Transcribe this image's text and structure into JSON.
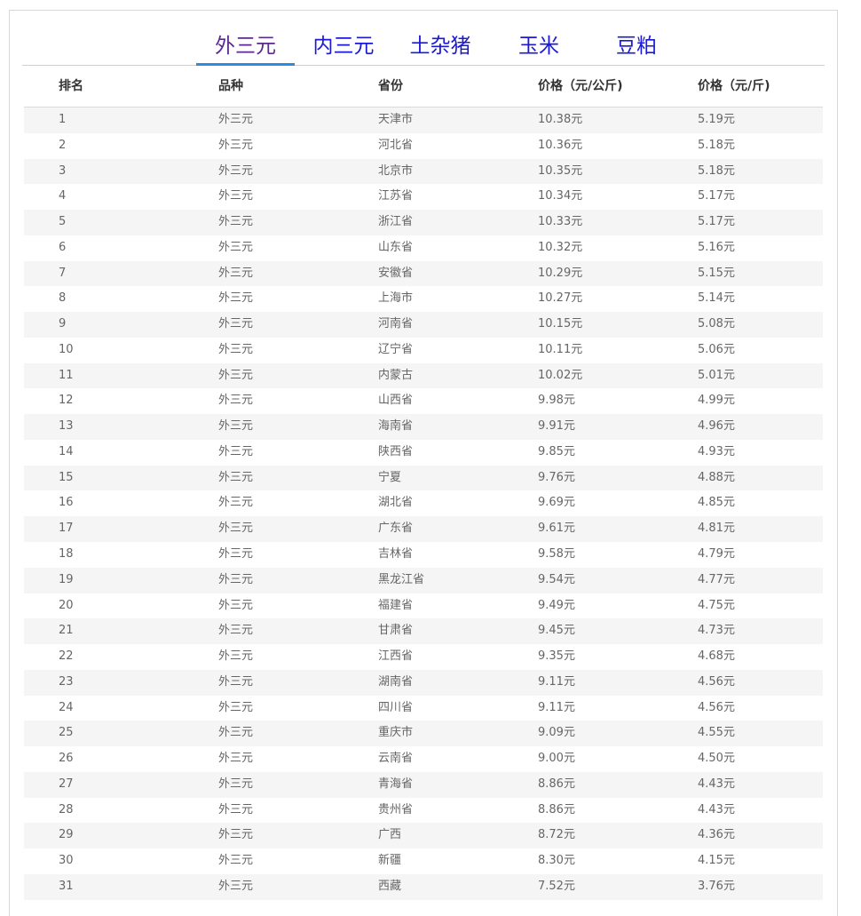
{
  "tabs": [
    {
      "label": "外三元",
      "active": true
    },
    {
      "label": "内三元",
      "active": false
    },
    {
      "label": "土杂猪",
      "active": false
    },
    {
      "label": "玉米",
      "active": false
    },
    {
      "label": "豆粕",
      "active": false
    }
  ],
  "table": {
    "headers": [
      "排名",
      "品种",
      "省份",
      "价格（元/公斤)",
      "价格（元/斤)"
    ],
    "rows": [
      [
        "1",
        "外三元",
        "天津市",
        "10.38元",
        "5.19元"
      ],
      [
        "2",
        "外三元",
        "河北省",
        "10.36元",
        "5.18元"
      ],
      [
        "3",
        "外三元",
        "北京市",
        "10.35元",
        "5.18元"
      ],
      [
        "4",
        "外三元",
        "江苏省",
        "10.34元",
        "5.17元"
      ],
      [
        "5",
        "外三元",
        "浙江省",
        "10.33元",
        "5.17元"
      ],
      [
        "6",
        "外三元",
        "山东省",
        "10.32元",
        "5.16元"
      ],
      [
        "7",
        "外三元",
        "安徽省",
        "10.29元",
        "5.15元"
      ],
      [
        "8",
        "外三元",
        "上海市",
        "10.27元",
        "5.14元"
      ],
      [
        "9",
        "外三元",
        "河南省",
        "10.15元",
        "5.08元"
      ],
      [
        "10",
        "外三元",
        "辽宁省",
        "10.11元",
        "5.06元"
      ],
      [
        "11",
        "外三元",
        "内蒙古",
        "10.02元",
        "5.01元"
      ],
      [
        "12",
        "外三元",
        "山西省",
        "9.98元",
        "4.99元"
      ],
      [
        "13",
        "外三元",
        "海南省",
        "9.91元",
        "4.96元"
      ],
      [
        "14",
        "外三元",
        "陕西省",
        "9.85元",
        "4.93元"
      ],
      [
        "15",
        "外三元",
        "宁夏",
        "9.76元",
        "4.88元"
      ],
      [
        "16",
        "外三元",
        "湖北省",
        "9.69元",
        "4.85元"
      ],
      [
        "17",
        "外三元",
        "广东省",
        "9.61元",
        "4.81元"
      ],
      [
        "18",
        "外三元",
        "吉林省",
        "9.58元",
        "4.79元"
      ],
      [
        "19",
        "外三元",
        "黑龙江省",
        "9.54元",
        "4.77元"
      ],
      [
        "20",
        "外三元",
        "福建省",
        "9.49元",
        "4.75元"
      ],
      [
        "21",
        "外三元",
        "甘肃省",
        "9.45元",
        "4.73元"
      ],
      [
        "22",
        "外三元",
        "江西省",
        "9.35元",
        "4.68元"
      ],
      [
        "23",
        "外三元",
        "湖南省",
        "9.11元",
        "4.56元"
      ],
      [
        "24",
        "外三元",
        "四川省",
        "9.11元",
        "4.56元"
      ],
      [
        "25",
        "外三元",
        "重庆市",
        "9.09元",
        "4.55元"
      ],
      [
        "26",
        "外三元",
        "云南省",
        "9.00元",
        "4.50元"
      ],
      [
        "27",
        "外三元",
        "青海省",
        "8.86元",
        "4.43元"
      ],
      [
        "28",
        "外三元",
        "贵州省",
        "8.86元",
        "4.43元"
      ],
      [
        "29",
        "外三元",
        "广西",
        "8.72元",
        "4.36元"
      ],
      [
        "30",
        "外三元",
        "新疆",
        "8.30元",
        "4.15元"
      ],
      [
        "31",
        "外三元",
        "西藏",
        "7.52元",
        "3.76元"
      ]
    ]
  },
  "colors": {
    "tab_text": "#1a1ad6",
    "tab_active_text": "#5a2a8e",
    "tab_underline": "#2a8be0",
    "row_stripe": "#f5f5f5"
  }
}
